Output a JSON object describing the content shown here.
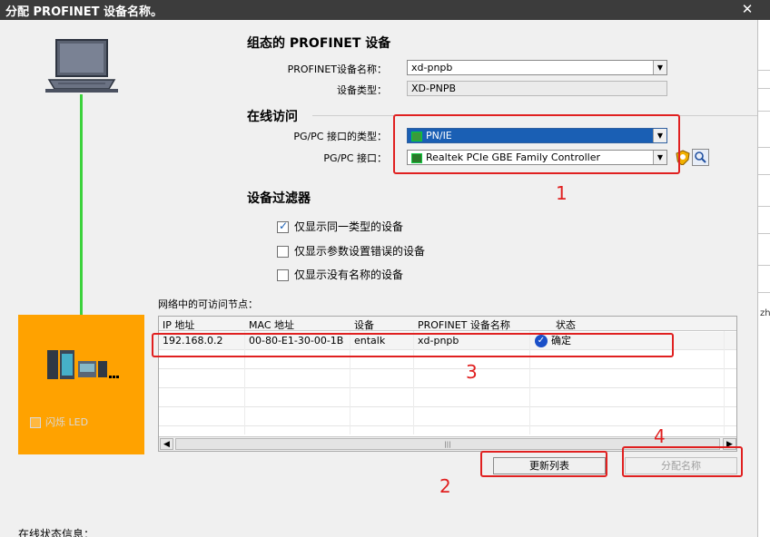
{
  "window": {
    "title": "分配 PROFINET 设备名称。",
    "close_glyph": "✕"
  },
  "left_panel": {
    "flash_led_label": "闪烁 LED"
  },
  "config_section": {
    "title": "组态的 PROFINET 设备",
    "device_name_label": "PROFINET设备名称：",
    "device_name_value": "xd-pnpb",
    "device_type_label": "设备类型：",
    "device_type_value": "XD-PNPB"
  },
  "online_section": {
    "title": "在线访问",
    "interface_type_label": "PG/PC 接口的类型：",
    "interface_type_value": "PN/IE",
    "interface_label": "PG/PC 接口：",
    "interface_value": "Realtek PCIe GBE Family Controller"
  },
  "filter_section": {
    "title": "设备过滤器",
    "options": [
      {
        "label": "仅显示同一类型的设备",
        "checked": true
      },
      {
        "label": "仅显示参数设置错误的设备",
        "checked": false
      },
      {
        "label": "仅显示没有名称的设备",
        "checked": false
      }
    ]
  },
  "nodes_table": {
    "caption": "网络中的可访问节点：",
    "columns": [
      "IP 地址",
      "MAC 地址",
      "设备",
      "PROFINET 设备名称",
      "状态"
    ],
    "rows": [
      {
        "ip": "192.168.0.2",
        "mac": "00-80-E1-30-00-1B",
        "device": "entalk",
        "name": "xd-pnpb",
        "status": "确定"
      }
    ]
  },
  "buttons": {
    "update_list": "更新列表",
    "assign_name": "分配名称"
  },
  "annotations": [
    "1",
    "2",
    "3",
    "4"
  ],
  "status_section": {
    "label": "在线状态信息："
  },
  "right_strip_text": "zh",
  "colors": {
    "accent_green": "#3cd23c",
    "device_panel": "#ffa200",
    "annotation_red": "#e02020",
    "selection_blue": "#1a5fb4"
  }
}
